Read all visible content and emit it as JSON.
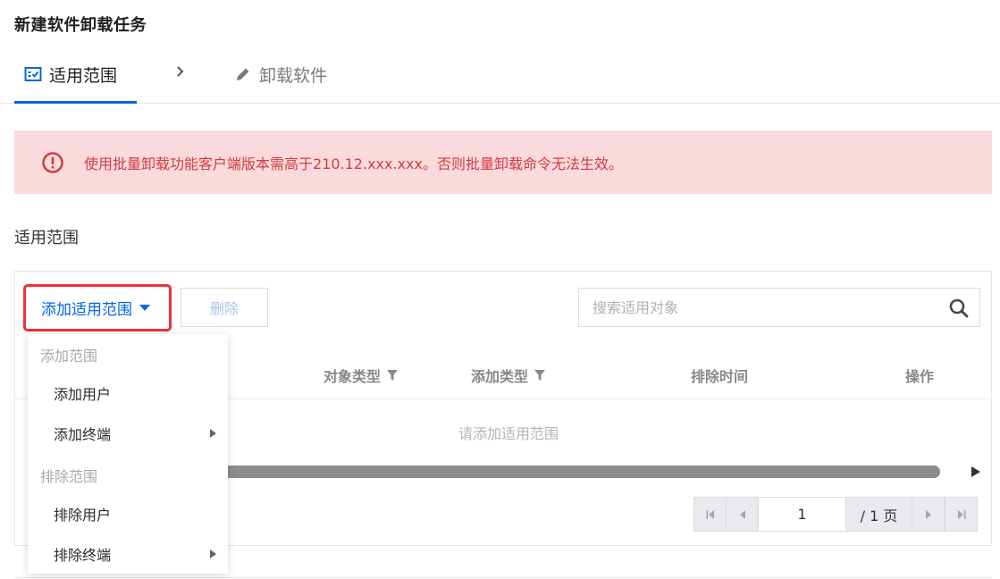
{
  "page_title": "新建软件卸载任务",
  "tabs": {
    "active_label": "适用范围",
    "inactive_label": "卸载软件"
  },
  "alert": {
    "text": "使用批量卸载功能客户端版本需高于210.12.xxx.xxx。否则批量卸载命令无法生效。"
  },
  "section_title": "适用范围",
  "toolbar": {
    "add_scope_label": "添加适用范围",
    "delete_label": "删除",
    "search_placeholder": "搜索适用对象"
  },
  "dropdown": {
    "groups": [
      {
        "label": "添加范围",
        "items": [
          {
            "label": "添加用户"
          },
          {
            "label": "添加终端"
          }
        ]
      },
      {
        "label": "排除范围",
        "items": [
          {
            "label": "排除用户"
          },
          {
            "label": "排除终端"
          }
        ]
      }
    ]
  },
  "table": {
    "columns": [
      "对象类型",
      "添加类型",
      "排除时间",
      "操作"
    ],
    "empty_text": "请添加适用范围"
  },
  "pagination": {
    "current_page": "1",
    "total_label": "/ 1 页"
  },
  "colors": {
    "accent": "#0066e6",
    "alert_bg": "#fadadd",
    "alert_text": "#d23c3c",
    "highlight_border": "#ee2f3b"
  },
  "icons": {
    "tab_active": "checklist-icon",
    "tab_inactive": "pencil-icon",
    "alert": "exclamation-circle-icon",
    "search": "search-icon",
    "filter": "filter-icon"
  }
}
